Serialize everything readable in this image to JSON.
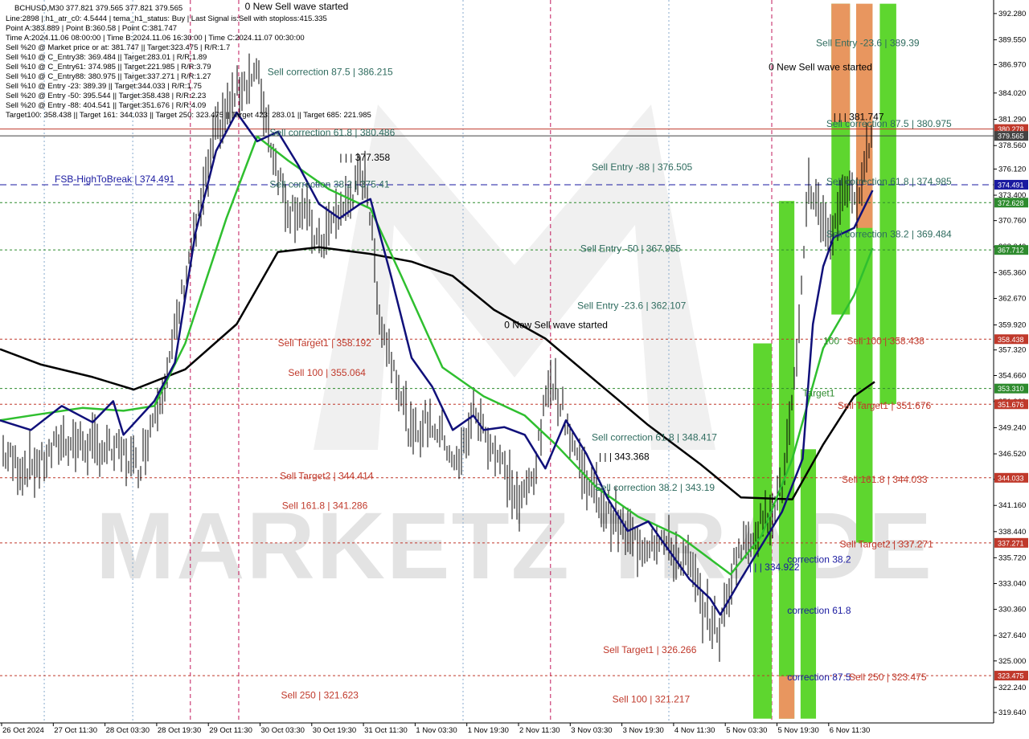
{
  "chart_data": {
    "type": "candlestick",
    "symbol": "BCHUSD,M30",
    "ohlc_header": "377.821 379.565 377.821 379.565",
    "watermark": "MARKETZ TRADE",
    "ylim": [
      318.89,
      393.27
    ],
    "y_ticks": [
      "392.280",
      "389.550",
      "386.970",
      "384.020",
      "381.290",
      "378.560",
      "376.120",
      "373.400",
      "370.760",
      "368.040",
      "365.360",
      "362.670",
      "359.920",
      "357.320",
      "354.660",
      "351.960",
      "349.240",
      "346.520",
      "343.880",
      "341.160",
      "338.440",
      "335.720",
      "333.040",
      "330.360",
      "327.640",
      "325.000",
      "322.240",
      "319.640"
    ],
    "x_ticks": [
      "26 Oct 2024",
      "27 Oct 11:30",
      "28 Oct 03:30",
      "28 Oct 19:30",
      "29 Oct 11:30",
      "30 Oct 03:30",
      "30 Oct 19:30",
      "31 Oct 11:30",
      "1 Nov 03:30",
      "1 Nov 19:30",
      "2 Nov 11:30",
      "3 Nov 03:30",
      "3 Nov 19:30",
      "4 Nov 11:30",
      "5 Nov 03:30",
      "5 Nov 19:30",
      "6 Nov 11:30"
    ],
    "info_lines": [
      "Line:2898 | h1_atr_c0: 4.5444 | tema_h1_status: Buy | Last Signal is:Sell with stoploss:415.335",
      "Point A:383.889 | Point B:360.58 | Point C:381.747",
      "Time A:2024.11.06 08:00:00 | Time B:2024.11.06 16:30:00 | Time C:2024.11.07 00:30:00",
      "Sell %20 @ Market price or at: 381.747 || Target:323.475 | R/R:1.7",
      "Sell %10 @ C_Entry38: 369.484 || Target:283.01 | R/R:1.89",
      "Sell %10 @ C_Entry61: 374.985 || Target:221.985 | R/R:3.79",
      "Sell %10 @ C_Entry88: 380.975 || Target:337.271 | R/R:1.27",
      "Sell %10 @ Entry -23: 389.39 || Target:344.033 | R/R:1.75",
      "Sell %20 @ Entry -50: 395.544 || Target:358.438 | R/R:2.23",
      "Sell %20 @ Entry -88: 404.541 || Target:351.676 | R/R:4.09",
      "Target100: 358.438 || Target 161: 344.033 || Target 250: 323.475 || Target 423: 283.01 || Target 685: 221.985"
    ],
    "hlines": [
      {
        "price": 380.278,
        "tag": "380.278",
        "color": "#c0392b",
        "style": "solid"
      },
      {
        "price": 379.565,
        "tag": "379.565",
        "color": "#444444",
        "style": "solid"
      },
      {
        "price": 374.491,
        "tag": "374.491",
        "color": "#1a1aa0",
        "style": "dash",
        "label": "FSB-HighToBreak | 374.491"
      },
      {
        "price": 372.628,
        "tag": "372.628",
        "color": "#2e8b2e",
        "style": "dot"
      },
      {
        "price": 367.712,
        "tag": "367.712",
        "color": "#2e8b2e",
        "style": "dot"
      },
      {
        "price": 358.438,
        "tag": "358.438",
        "color": "#c0392b",
        "style": "dot"
      },
      {
        "price": 353.31,
        "tag": "353.310",
        "color": "#2e8b2e",
        "style": "dot"
      },
      {
        "price": 351.676,
        "tag": "351.676",
        "color": "#c0392b",
        "style": "dot"
      },
      {
        "price": 344.033,
        "tag": "344.033",
        "color": "#c0392b",
        "style": "dot"
      },
      {
        "price": 337.271,
        "tag": "337.271",
        "color": "#c0392b",
        "style": "dot"
      },
      {
        "price": 323.475,
        "tag": "323.475",
        "color": "#c0392b",
        "style": "dot"
      }
    ],
    "annotations": [
      {
        "text": "0 New Sell wave started",
        "price": 392.7,
        "time": 0.238,
        "color": "#000"
      },
      {
        "text": "Sell correction 87.5 | 386.215",
        "price": 385.9,
        "time": 0.26,
        "color": "#2e6b5e"
      },
      {
        "text": "| | | 377.358",
        "price": 377.0,
        "time": 0.33,
        "color": "#000"
      },
      {
        "text": "Sell correction 61.8 | 380.486",
        "price": 379.6,
        "time": 0.262,
        "color": "#2e6b5e"
      },
      {
        "text": "Sell correction 38.2 | 375.41",
        "price": 374.2,
        "time": 0.262,
        "color": "#2e6b5e"
      },
      {
        "text": "Sell Entry -88 | 376.505",
        "price": 376.0,
        "time": 0.575,
        "color": "#2e6b5e"
      },
      {
        "text": "Sell Entry -50 | 367.955",
        "price": 367.5,
        "time": 0.564,
        "color": "#2e6b5e"
      },
      {
        "text": "Sell Entry -23.6 | 362.107",
        "price": 361.6,
        "time": 0.561,
        "color": "#2e6b5e"
      },
      {
        "text": "0 New Sell wave started",
        "price": 359.6,
        "time": 0.49,
        "color": "#000"
      },
      {
        "text": "Sell Target1 | 358.192",
        "price": 357.7,
        "time": 0.27,
        "color": "#c0392b"
      },
      {
        "text": "Sell 100 | 355.064",
        "price": 354.6,
        "time": 0.28,
        "color": "#c0392b"
      },
      {
        "text": "Sell correction 61.8 | 348.417",
        "price": 347.9,
        "time": 0.575,
        "color": "#2e6b5e"
      },
      {
        "text": "| | | 343.368",
        "price": 345.9,
        "time": 0.582,
        "color": "#000"
      },
      {
        "text": "Sell correction 38.2 | 343.19",
        "price": 342.7,
        "time": 0.578,
        "color": "#2e6b5e"
      },
      {
        "text": "Sell Target2 | 344.414",
        "price": 343.9,
        "time": 0.272,
        "color": "#c0392b"
      },
      {
        "text": "Sell 161.8 | 341.286",
        "price": 340.8,
        "time": 0.274,
        "color": "#c0392b"
      },
      {
        "text": "| | | 334.922",
        "price": 334.4,
        "time": 0.728,
        "color": "#1a1aa0"
      },
      {
        "text": "Sell Target1 | 326.266",
        "price": 325.8,
        "time": 0.586,
        "color": "#c0392b"
      },
      {
        "text": "Sell  250 | 321.623",
        "price": 321.1,
        "time": 0.273,
        "color": "#c0392b"
      },
      {
        "text": "Sell 100 | 321.217",
        "price": 320.7,
        "time": 0.595,
        "color": "#c0392b"
      },
      {
        "text": "Sell Entry -23.6 | 389.39",
        "price": 388.9,
        "time": 0.793,
        "color": "#2e6b5e"
      },
      {
        "text": "0 New Sell wave started",
        "price": 386.4,
        "time": 0.747,
        "color": "#000"
      },
      {
        "text": "| | | 381.747",
        "price": 381.2,
        "time": 0.81,
        "color": "#000"
      },
      {
        "text": "Sell correction 87.5 | 380.975",
        "price": 380.5,
        "time": 0.803,
        "color": "#2e6b5e"
      },
      {
        "text": "Sell correction 61.8 | 374.985",
        "price": 374.5,
        "time": 0.803,
        "color": "#2e6b5e"
      },
      {
        "text": "Sell correction 38.2 | 369.484",
        "price": 369.0,
        "time": 0.803,
        "color": "#2e6b5e"
      },
      {
        "text": "Sell 100 | 358.438",
        "price": 357.9,
        "time": 0.823,
        "color": "#c0392b"
      },
      {
        "text": "Sell Target1 | 351.676",
        "price": 351.2,
        "time": 0.814,
        "color": "#c0392b"
      },
      {
        "text": "Sell 161.8 | 344.033",
        "price": 343.5,
        "time": 0.818,
        "color": "#c0392b"
      },
      {
        "text": "Sell Target2 | 337.271",
        "price": 336.8,
        "time": 0.816,
        "color": "#c0392b"
      },
      {
        "text": "Sell  250 | 323.475",
        "price": 323.0,
        "time": 0.825,
        "color": "#c0392b"
      },
      {
        "text": "correction 38.2",
        "price": 335.2,
        "time": 0.765,
        "color": "#1a1aa0"
      },
      {
        "text": "correction 61.8",
        "price": 329.9,
        "time": 0.765,
        "color": "#1a1aa0"
      },
      {
        "text": "correction 87.5",
        "price": 323.0,
        "time": 0.765,
        "color": "#1a1aa0"
      },
      {
        "text": "Target1",
        "price": 352.5,
        "time": 0.78,
        "color": "#2e8b2e"
      },
      {
        "text": "100",
        "price": 357.9,
        "time": 0.8,
        "color": "#2e8b2e"
      }
    ],
    "ma_black": [
      [
        0,
        357.4
      ],
      [
        0.04,
        355.8
      ],
      [
        0.09,
        354.5
      ],
      [
        0.13,
        353.2
      ],
      [
        0.18,
        355.3
      ],
      [
        0.23,
        360.0
      ],
      [
        0.27,
        367.5
      ],
      [
        0.31,
        368.0
      ],
      [
        0.36,
        367.3
      ],
      [
        0.4,
        366.5
      ],
      [
        0.44,
        365.0
      ],
      [
        0.48,
        361.5
      ],
      [
        0.53,
        358.5
      ],
      [
        0.58,
        354.0
      ],
      [
        0.63,
        349.5
      ],
      [
        0.68,
        345.5
      ],
      [
        0.72,
        342.0
      ],
      [
        0.77,
        341.8
      ],
      [
        0.8,
        347.5
      ],
      [
        0.83,
        352.5
      ],
      [
        0.85,
        354.0
      ]
    ],
    "ma_green": [
      [
        0,
        350.0
      ],
      [
        0.03,
        350.5
      ],
      [
        0.08,
        351.3
      ],
      [
        0.12,
        351.0
      ],
      [
        0.15,
        351.5
      ],
      [
        0.18,
        358.0
      ],
      [
        0.22,
        371.0
      ],
      [
        0.25,
        379.5
      ],
      [
        0.28,
        377.0
      ],
      [
        0.32,
        374.0
      ],
      [
        0.36,
        372.0
      ],
      [
        0.39,
        365.0
      ],
      [
        0.43,
        355.5
      ],
      [
        0.47,
        352.5
      ],
      [
        0.51,
        350.5
      ],
      [
        0.54,
        347.5
      ],
      [
        0.58,
        343.0
      ],
      [
        0.62,
        340.0
      ],
      [
        0.66,
        338.0
      ],
      [
        0.71,
        334.0
      ],
      [
        0.74,
        338.0
      ],
      [
        0.77,
        346.0
      ],
      [
        0.8,
        357.5
      ],
      [
        0.83,
        363.0
      ],
      [
        0.848,
        367.9
      ]
    ],
    "ma_blue": [
      [
        0,
        350.0
      ],
      [
        0.03,
        349.0
      ],
      [
        0.06,
        351.5
      ],
      [
        0.09,
        349.8
      ],
      [
        0.11,
        352.0
      ],
      [
        0.12,
        348.5
      ],
      [
        0.15,
        352.0
      ],
      [
        0.17,
        356.0
      ],
      [
        0.19,
        369.5
      ],
      [
        0.21,
        378.0
      ],
      [
        0.23,
        382.0
      ],
      [
        0.25,
        379.0
      ],
      [
        0.27,
        380.0
      ],
      [
        0.29,
        376.5
      ],
      [
        0.31,
        372.5
      ],
      [
        0.33,
        371.0
      ],
      [
        0.35,
        372.5
      ],
      [
        0.36,
        373.0
      ],
      [
        0.38,
        365.0
      ],
      [
        0.4,
        356.5
      ],
      [
        0.42,
        353.5
      ],
      [
        0.44,
        349.0
      ],
      [
        0.46,
        350.5
      ],
      [
        0.47,
        349.0
      ],
      [
        0.49,
        349.3
      ],
      [
        0.51,
        348.5
      ],
      [
        0.53,
        345.0
      ],
      [
        0.55,
        350.0
      ],
      [
        0.57,
        346.5
      ],
      [
        0.59,
        342.0
      ],
      [
        0.61,
        338.5
      ],
      [
        0.63,
        339.5
      ],
      [
        0.65,
        336.5
      ],
      [
        0.67,
        333.5
      ],
      [
        0.69,
        331.5
      ],
      [
        0.7,
        329.8
      ],
      [
        0.72,
        333.5
      ],
      [
        0.74,
        337.0
      ],
      [
        0.76,
        340.5
      ],
      [
        0.78,
        346.0
      ],
      [
        0.79,
        360.0
      ],
      [
        0.8,
        366.0
      ],
      [
        0.81,
        369.0
      ],
      [
        0.83,
        370.0
      ],
      [
        0.848,
        373.9
      ]
    ],
    "candle_bars": [
      [
        0,
        347
      ],
      [
        0.02,
        345
      ],
      [
        0.04,
        345.5
      ],
      [
        0.06,
        348
      ],
      [
        0.08,
        347.5
      ],
      [
        0.1,
        347
      ],
      [
        0.12,
        346.5
      ],
      [
        0.135,
        345
      ],
      [
        0.15,
        351
      ],
      [
        0.165,
        356
      ],
      [
        0.18,
        365
      ],
      [
        0.195,
        372
      ],
      [
        0.21,
        380
      ],
      [
        0.225,
        383
      ],
      [
        0.235,
        385
      ],
      [
        0.25,
        386
      ],
      [
        0.265,
        378
      ],
      [
        0.28,
        372
      ],
      [
        0.295,
        372
      ],
      [
        0.31,
        368
      ],
      [
        0.325,
        371
      ],
      [
        0.34,
        373
      ],
      [
        0.355,
        376
      ],
      [
        0.37,
        360
      ],
      [
        0.385,
        355
      ],
      [
        0.4,
        348
      ],
      [
        0.415,
        350
      ],
      [
        0.43,
        348.5
      ],
      [
        0.445,
        345
      ],
      [
        0.46,
        351
      ],
      [
        0.475,
        348
      ],
      [
        0.49,
        345
      ],
      [
        0.505,
        341
      ],
      [
        0.52,
        345
      ],
      [
        0.535,
        355
      ],
      [
        0.55,
        350
      ],
      [
        0.565,
        345
      ],
      [
        0.58,
        342
      ],
      [
        0.595,
        340
      ],
      [
        0.61,
        338
      ],
      [
        0.625,
        337
      ],
      [
        0.64,
        338
      ],
      [
        0.655,
        336
      ],
      [
        0.67,
        335
      ],
      [
        0.685,
        330
      ],
      [
        0.7,
        328
      ],
      [
        0.715,
        336
      ],
      [
        0.73,
        338
      ],
      [
        0.745,
        340
      ],
      [
        0.76,
        343
      ],
      [
        0.775,
        356
      ],
      [
        0.785,
        375
      ],
      [
        0.795,
        372
      ],
      [
        0.81,
        369
      ],
      [
        0.82,
        375
      ],
      [
        0.83,
        372
      ],
      [
        0.84,
        377
      ],
      [
        0.848,
        379.6
      ]
    ],
    "vertical_lines": [
      {
        "time": 0.185,
        "color": "#c2185b",
        "style": "dash"
      },
      {
        "time": 0.232,
        "color": "#c2185b",
        "style": "dash"
      },
      {
        "time": 0.535,
        "color": "#c2185b",
        "style": "dash"
      },
      {
        "time": 0.75,
        "color": "#c2185b",
        "style": "dash"
      },
      {
        "time": 0.043,
        "color": "#87aacc",
        "style": "dot"
      },
      {
        "time": 0.129,
        "color": "#87aacc",
        "style": "dot"
      },
      {
        "time": 0.45,
        "color": "#87aacc",
        "style": "dot"
      },
      {
        "time": 0.65,
        "color": "#87aacc",
        "style": "dot"
      }
    ],
    "zones": [
      {
        "t0": 0.732,
        "t1": 0.75,
        "p0": 319.0,
        "p1": 358.0,
        "color": "#5ed62f"
      },
      {
        "t0": 0.757,
        "t1": 0.772,
        "p0": 319.0,
        "p1": 372.8,
        "color": "#5ed62f"
      },
      {
        "t0": 0.757,
        "t1": 0.772,
        "p0": 319.0,
        "p1": 323.4,
        "color": "#e8965f"
      },
      {
        "t0": 0.778,
        "t1": 0.793,
        "p0": 319.0,
        "p1": 347.0,
        "color": "#5ed62f"
      },
      {
        "t0": 0.808,
        "t1": 0.826,
        "p0": 361.0,
        "p1": 393.3,
        "color": "#5ed62f"
      },
      {
        "t0": 0.808,
        "t1": 0.826,
        "p0": 381.0,
        "p1": 393.3,
        "color": "#e8965f"
      },
      {
        "t0": 0.832,
        "t1": 0.848,
        "p0": 337.3,
        "p1": 378.0,
        "color": "#5ed62f"
      },
      {
        "t0": 0.832,
        "t1": 0.848,
        "p0": 370.0,
        "p1": 393.3,
        "color": "#e8965f"
      },
      {
        "t0": 0.855,
        "t1": 0.871,
        "p0": 351.7,
        "p1": 393.3,
        "color": "#5ed62f"
      }
    ]
  }
}
